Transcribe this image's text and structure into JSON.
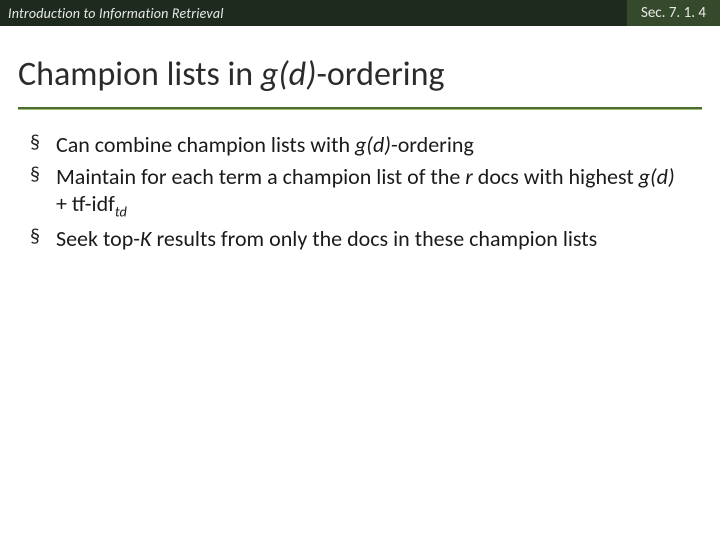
{
  "header": {
    "left": "Introduction to Information Retrieval",
    "right": "Sec. 7. 1. 4"
  },
  "title": {
    "pre": "Champion lists in ",
    "gd": "g(d)",
    "post": "-ordering"
  },
  "bullets": [
    {
      "pre": "Can combine champion lists with ",
      "gd": "g(d)",
      "post": "-ordering"
    },
    {
      "t1": "Maintain for each term a champion list of the ",
      "r": "r",
      "t2": " docs with highest ",
      "gd": "g(d)",
      "t3": " + tf-idf",
      "sub": "td"
    },
    {
      "t1": "Seek top-",
      "k": "K",
      "t2": " results from only the docs in these champion lists"
    }
  ]
}
